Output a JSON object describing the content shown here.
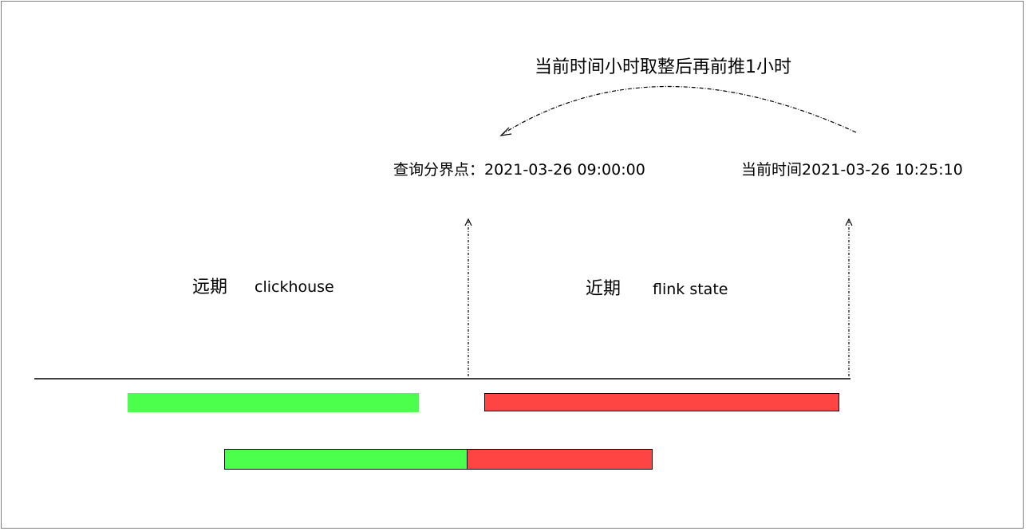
{
  "labels": {
    "arrow_caption": "当前时间小时取整后再前推1小时",
    "boundary_label": "查询分界点：2021-03-26 09:00:00",
    "current_time_label": "当前时间2021-03-26 10:25:10",
    "far_period": "远期",
    "far_source": "clickhouse",
    "near_period": "近期",
    "near_source": "flink state"
  },
  "colors": {
    "far_bar": "#4dff4d",
    "near_bar": "#ff4444",
    "axis": "#000000"
  }
}
